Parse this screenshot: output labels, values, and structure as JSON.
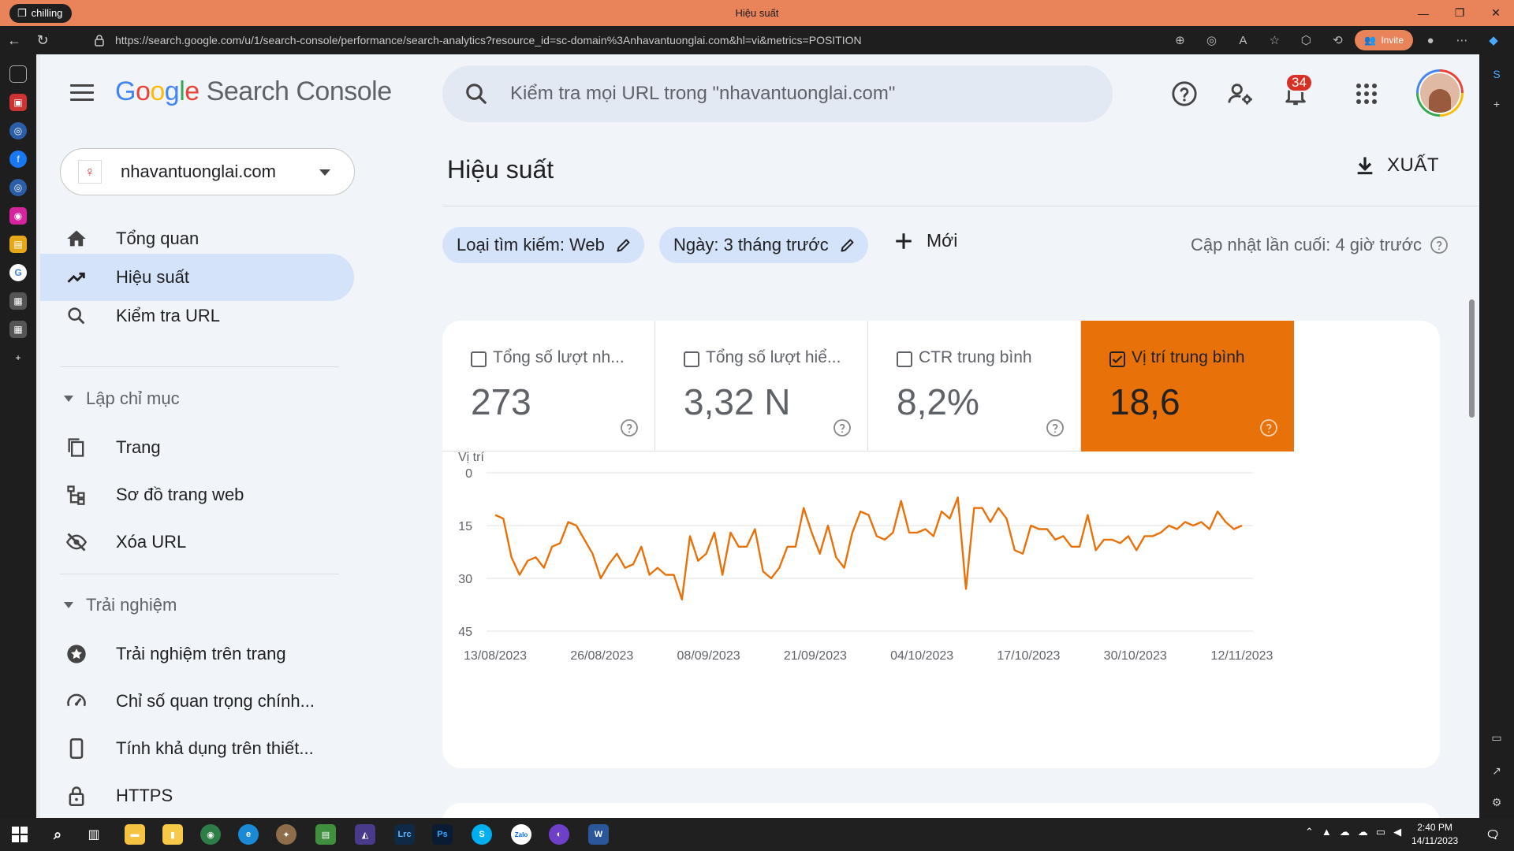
{
  "browser": {
    "profile": "chilling",
    "tab_title": "Hiệu suất",
    "url": "https://search.google.com/u/1/search-console/performance/search-analytics?resource_id=sc-domain%3Anhavantuonglai.com&hl=vi&metrics=POSITION",
    "invite_label": "Invite"
  },
  "header": {
    "logo_parts": [
      "G",
      "o",
      "o",
      "g",
      "l",
      "e"
    ],
    "product": "Search Console",
    "search_placeholder": "Kiểm tra mọi URL trong \"nhavantuonglai.com\"",
    "notification_count": "34"
  },
  "sidebar": {
    "property": "nhavantuonglai.com",
    "items_top": [
      {
        "label": "Tổng quan",
        "icon": "home-icon"
      },
      {
        "label": "Hiệu suất",
        "icon": "trending-up-icon",
        "active": true
      },
      {
        "label": "Kiểm tra URL",
        "icon": "search-icon"
      }
    ],
    "section_index": "Lập chỉ mục",
    "items_index": [
      {
        "label": "Trang",
        "icon": "pages-icon"
      },
      {
        "label": "Sơ đồ trang web",
        "icon": "sitemap-icon"
      },
      {
        "label": "Xóa URL",
        "icon": "eye-off-icon"
      }
    ],
    "section_experience": "Trải nghiệm",
    "items_experience": [
      {
        "label": "Trải nghiệm trên trang",
        "icon": "star-badge-icon"
      },
      {
        "label": "Chỉ số quan trọng chính...",
        "icon": "gauge-icon"
      },
      {
        "label": "Tính khả dụng trên thiết...",
        "icon": "phone-icon"
      },
      {
        "label": "HTTPS",
        "icon": "lock-icon"
      }
    ]
  },
  "main": {
    "title": "Hiệu suất",
    "export_label": "XUẤT",
    "filters": [
      {
        "label": "Loại tìm kiếm: Web"
      },
      {
        "label": "Ngày: 3 tháng trước"
      }
    ],
    "new_label": "Mới",
    "last_updated": "Cập nhật lần cuối: 4 giờ trước",
    "metrics": [
      {
        "label": "Tổng số lượt nh...",
        "value": "273",
        "checked": false
      },
      {
        "label": "Tổng số lượt hiể...",
        "value": "3,32 N",
        "checked": false
      },
      {
        "label": "CTR trung bình",
        "value": "8,2%",
        "checked": false
      },
      {
        "label": "Vị trí trung bình",
        "value": "18,6",
        "checked": true
      }
    ]
  },
  "colors": {
    "accent": "#e8710a",
    "chip_bg": "#d5e3fa",
    "titlebar": "#e8835a"
  },
  "chart_data": {
    "type": "line",
    "ylabel": "Vị trí",
    "yticks": [
      "0",
      "15",
      "30",
      "45"
    ],
    "ylim": [
      0,
      45
    ],
    "y_inverted": true,
    "xtick_labels": [
      "13/08/2023",
      "26/08/2023",
      "08/09/2023",
      "21/09/2023",
      "04/10/2023",
      "17/10/2023",
      "30/10/2023",
      "12/11/2023"
    ],
    "x_start": "2023-08-13",
    "series": [
      {
        "color": "#e8710a",
        "values": [
          12,
          13,
          24,
          29,
          25,
          24,
          27,
          21,
          20,
          14,
          15,
          19,
          23,
          30,
          26,
          23,
          27,
          26,
          21,
          29,
          27,
          29,
          29,
          36,
          18,
          25,
          23,
          17,
          29,
          17,
          21,
          21,
          16,
          28,
          30,
          27,
          21,
          21,
          10,
          17,
          23,
          15,
          24,
          27,
          17,
          11,
          12,
          18,
          19,
          17,
          8,
          17,
          17,
          16,
          18,
          11,
          13,
          7,
          33,
          10,
          10,
          14,
          10,
          13,
          22,
          23,
          15,
          16,
          16,
          19,
          18,
          21,
          21,
          12,
          22,
          19,
          19,
          20,
          18,
          22,
          18,
          18,
          17,
          15,
          16,
          14,
          15,
          14,
          16,
          11,
          14,
          16,
          15
        ]
      }
    ]
  },
  "taskbar": {
    "time": "2:40 PM",
    "date": "14/11/2023",
    "apps": [
      "Lrc",
      "Ps",
      "S",
      "Zalo",
      "W"
    ]
  }
}
